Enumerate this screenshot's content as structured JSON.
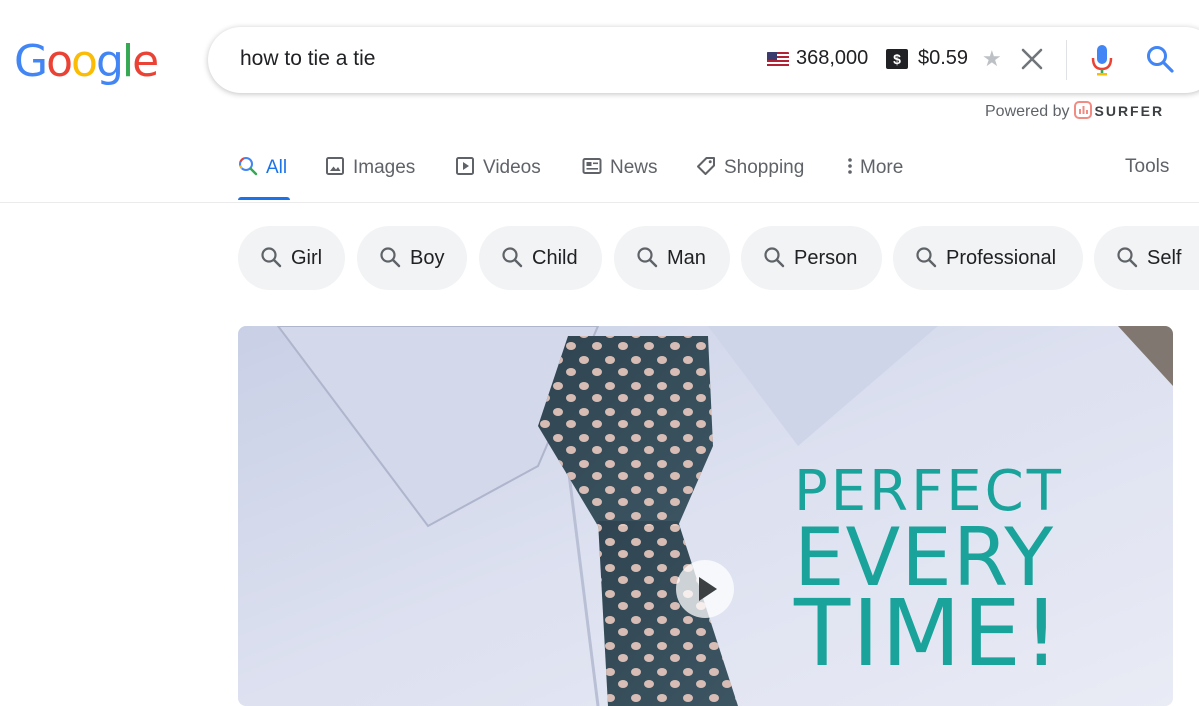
{
  "logo": {
    "letters": [
      "G",
      "o",
      "o",
      "g",
      "l",
      "e"
    ]
  },
  "search": {
    "query": "how to tie a tie",
    "search_volume": "368,000",
    "cpc": "$0.59",
    "dollar_badge": "$",
    "star": "★"
  },
  "extension": {
    "powered_by": "Powered by",
    "brand": "SURFER"
  },
  "tabs": [
    {
      "label": "All",
      "icon": "search-icon"
    },
    {
      "label": "Images",
      "icon": "image-icon"
    },
    {
      "label": "Videos",
      "icon": "play-icon"
    },
    {
      "label": "News",
      "icon": "news-icon"
    },
    {
      "label": "Shopping",
      "icon": "tag-icon"
    },
    {
      "label": "More",
      "icon": "more-vert-icon"
    }
  ],
  "tools_label": "Tools",
  "chips": [
    "Girl",
    "Boy",
    "Child",
    "Man",
    "Person",
    "Professional",
    "Self"
  ],
  "video": {
    "promo_lines": [
      "PERFECT",
      "EVERY",
      "TIME!"
    ]
  },
  "colors": {
    "google_blue": "#4285f4",
    "google_red": "#ea4335",
    "google_yellow": "#fbbc05",
    "google_green": "#34a853",
    "active_tab": "#1a73e8",
    "promo_teal": "#1aa39b"
  }
}
